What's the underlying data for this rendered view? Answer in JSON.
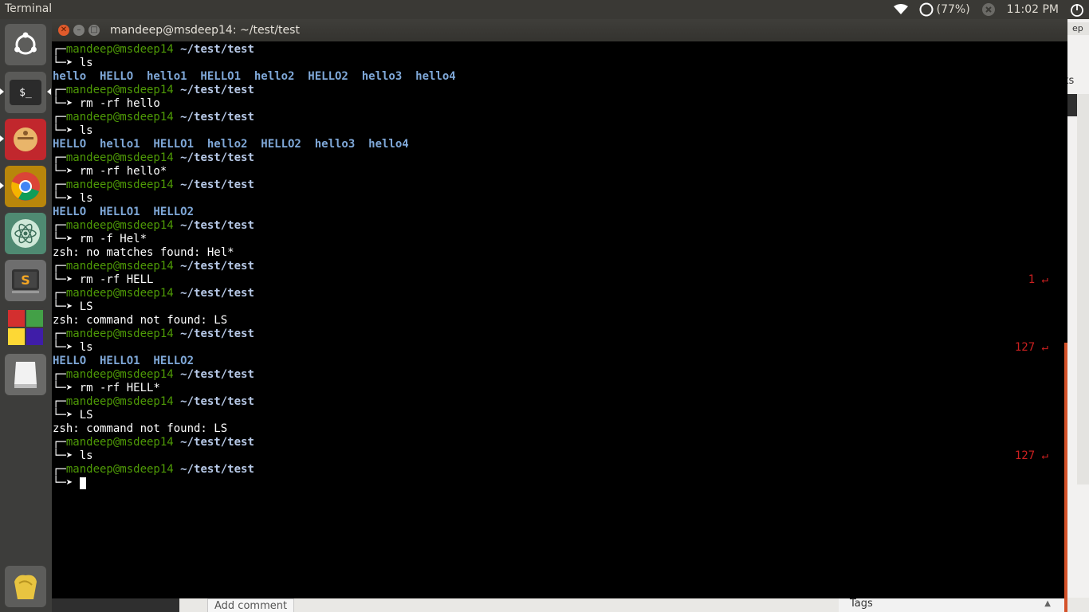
{
  "top_panel": {
    "app_title": "Terminal",
    "battery": "(77%)",
    "clock": "11:02 PM"
  },
  "window": {
    "title": "mandeep@msdeep14: ~/test/test"
  },
  "background": {
    "right_tab_label": "ep",
    "right_partial_text": "ks",
    "add_comment": "Add comment",
    "tags_label": "Tags"
  },
  "prompt": {
    "user": "mandeep@msdeep14",
    "path": "~/test/test",
    "arrow": "└─➤"
  },
  "terminal": {
    "lines": [
      {
        "kind": "prompt"
      },
      {
        "kind": "cmd",
        "text": "ls"
      },
      {
        "kind": "ls",
        "text": "hello  HELLO  hello1  HELLO1  hello2  HELLO2  hello3  hello4"
      },
      {
        "kind": "prompt"
      },
      {
        "kind": "cmd",
        "text": "rm -rf hello"
      },
      {
        "kind": "prompt"
      },
      {
        "kind": "cmd",
        "text": "ls"
      },
      {
        "kind": "ls",
        "text": "HELLO  hello1  HELLO1  hello2  HELLO2  hello3  hello4"
      },
      {
        "kind": "prompt"
      },
      {
        "kind": "cmd",
        "text": "rm -rf hello*"
      },
      {
        "kind": "prompt"
      },
      {
        "kind": "cmd",
        "text": "ls"
      },
      {
        "kind": "ls",
        "text": "HELLO  HELLO1  HELLO2"
      },
      {
        "kind": "prompt"
      },
      {
        "kind": "cmd",
        "text": "rm -f Hel*"
      },
      {
        "kind": "out",
        "text": "zsh: no matches found: Hel*"
      },
      {
        "kind": "prompt"
      },
      {
        "kind": "cmd",
        "text": "rm -rf HELL",
        "status": "1 ↵"
      },
      {
        "kind": "prompt"
      },
      {
        "kind": "cmd",
        "text": "LS"
      },
      {
        "kind": "out",
        "text": "zsh: command not found: LS"
      },
      {
        "kind": "prompt"
      },
      {
        "kind": "cmd",
        "text": "ls",
        "status": "127 ↵"
      },
      {
        "kind": "ls",
        "text": "HELLO  HELLO1  HELLO2"
      },
      {
        "kind": "prompt"
      },
      {
        "kind": "cmd",
        "text": "rm -rf HELL*"
      },
      {
        "kind": "prompt"
      },
      {
        "kind": "cmd",
        "text": "LS"
      },
      {
        "kind": "out",
        "text": "zsh: command not found: LS"
      },
      {
        "kind": "prompt"
      },
      {
        "kind": "cmd",
        "text": "ls",
        "status": "127 ↵"
      },
      {
        "kind": "prompt"
      },
      {
        "kind": "cursor"
      }
    ]
  },
  "launcher": {
    "items": [
      {
        "icon": "ubuntu-logo-icon"
      },
      {
        "icon": "terminal-icon"
      },
      {
        "icon": "file-archive-icon"
      },
      {
        "icon": "chrome-icon"
      },
      {
        "icon": "atom-icon"
      },
      {
        "icon": "sublime-text-icon"
      },
      {
        "icon": "office-icon"
      },
      {
        "icon": "removable-drive-icon"
      },
      {
        "icon": "trash-icon"
      }
    ]
  },
  "colors": {
    "prompt_user": "#4e9a06",
    "prompt_path": "#b6c8e6",
    "ls_output": "#7fa8d8",
    "exit_status": "#cc2020",
    "scrollbar": "#d4522a"
  }
}
